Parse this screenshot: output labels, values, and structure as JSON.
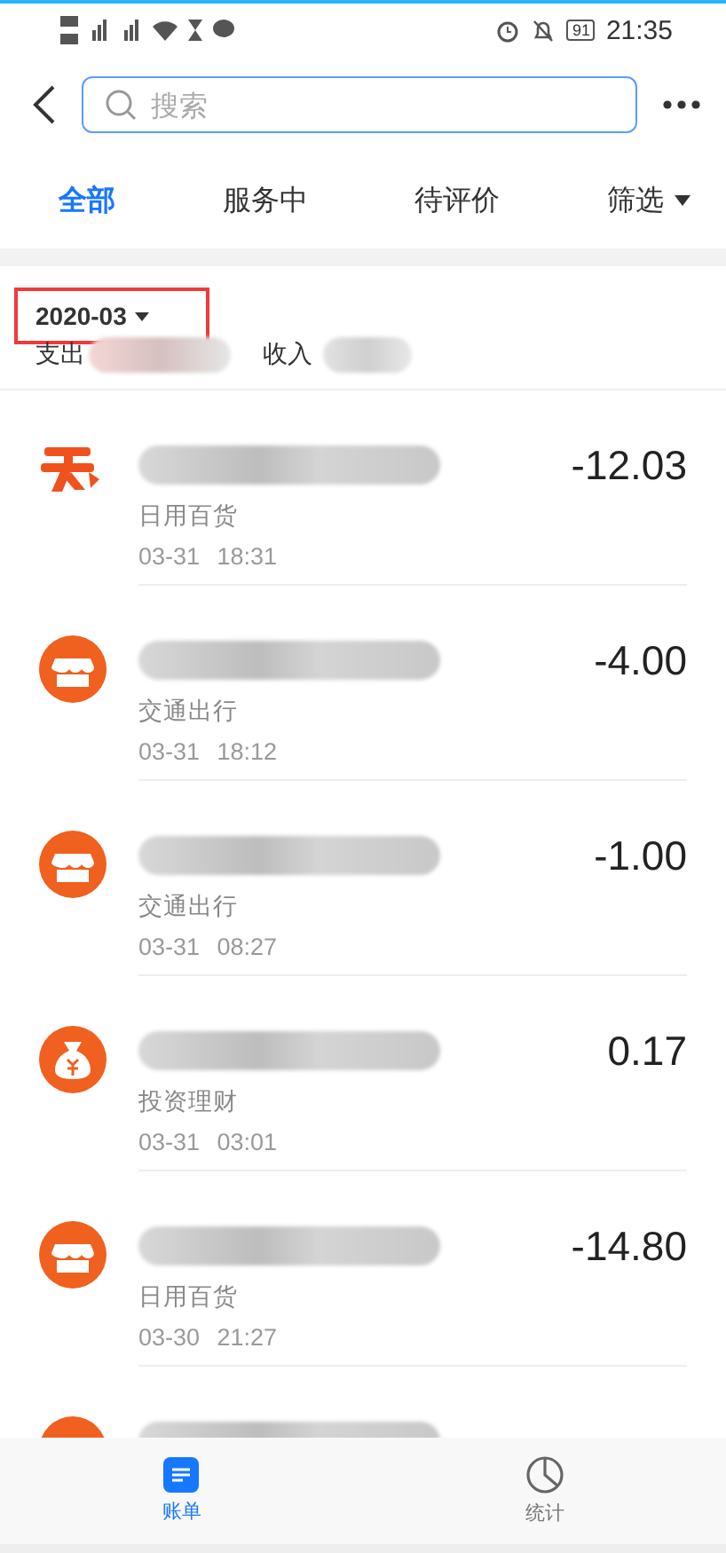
{
  "status_bar": {
    "battery": "91",
    "time": "21:35"
  },
  "search": {
    "placeholder": "搜索"
  },
  "tabs": [
    {
      "label": "全部",
      "selected": true
    },
    {
      "label": "服务中",
      "selected": false
    },
    {
      "label": "待评价",
      "selected": false
    }
  ],
  "filter": {
    "label": "筛选"
  },
  "month": {
    "label": "2020-03",
    "highlighted": true
  },
  "summary": {
    "expense_label": "支出",
    "income_label": "收入"
  },
  "bills": [
    {
      "kind": "logo",
      "category": "日用百货",
      "date": "03-31",
      "time": "18:31",
      "amount": "-12.03"
    },
    {
      "kind": "store",
      "category": "交通出行",
      "date": "03-31",
      "time": "18:12",
      "amount": "-4.00"
    },
    {
      "kind": "store",
      "category": "交通出行",
      "date": "03-31",
      "time": "08:27",
      "amount": "-1.00"
    },
    {
      "kind": "moneybag",
      "category": "投资理财",
      "date": "03-31",
      "time": "03:01",
      "amount": "0.17"
    },
    {
      "kind": "store",
      "category": "日用百货",
      "date": "03-30",
      "time": "21:27",
      "amount": "-14.80"
    },
    {
      "kind": "store"
    }
  ],
  "bottom_tabs": [
    {
      "label": "账单",
      "kind": "bill",
      "selected": true
    },
    {
      "label": "统计",
      "kind": "stats",
      "selected": false
    }
  ]
}
